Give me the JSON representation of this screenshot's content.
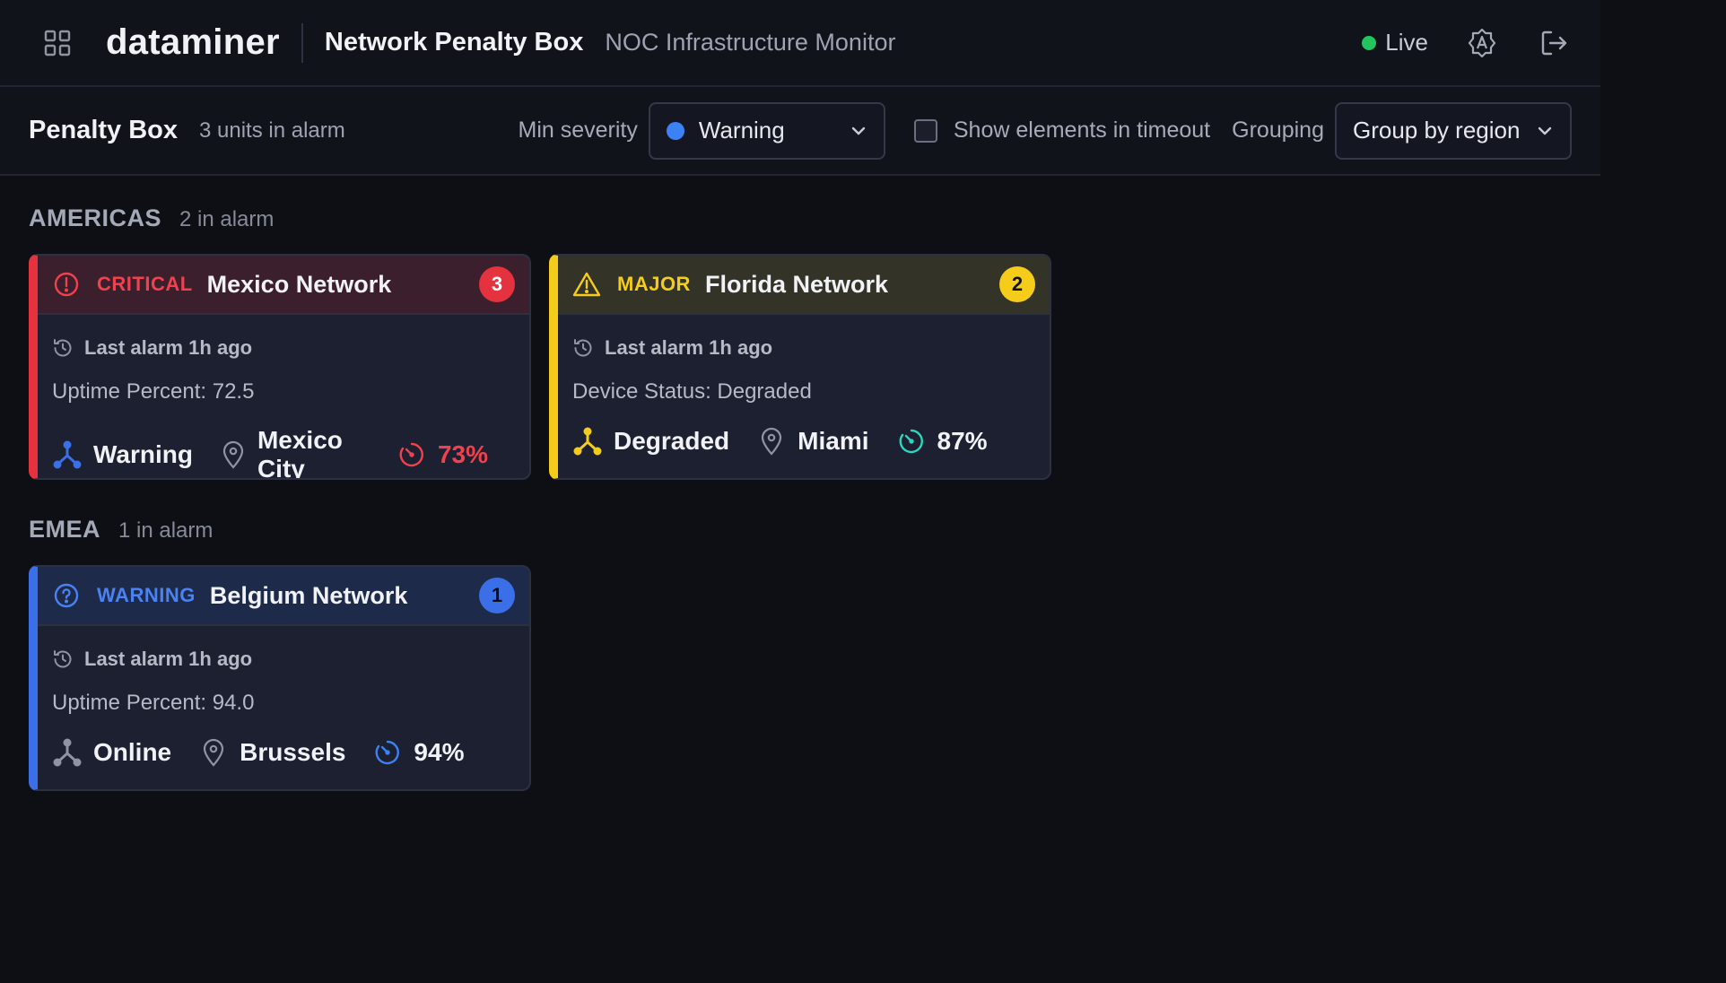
{
  "header": {
    "brand": "dataminer",
    "app_title": "Network Penalty Box",
    "app_subtitle": "NOC Infrastructure Monitor",
    "live_label": "Live"
  },
  "toolbar": {
    "title": "Penalty Box",
    "count": "3 units in alarm",
    "min_severity_label": "Min severity",
    "min_severity_value": "Warning",
    "timeout_label": "Show elements in timeout",
    "grouping_label": "Grouping",
    "grouping_value": "Group by region"
  },
  "colors": {
    "critical": "#e5323f",
    "major": "#f5cc1a",
    "warning": "#3b6fe8",
    "live": "#22c55e",
    "teal": "#2dd4bf"
  },
  "groups": [
    {
      "name": "AMERICAS",
      "count": "2 in alarm",
      "cards": [
        {
          "severity": "CRITICAL",
          "name": "Mexico Network",
          "badge": "3",
          "last_alarm": "Last alarm 1h ago",
          "detail": "Uptime Percent: 72.5",
          "status": "Warning",
          "location": "Mexico City",
          "uptime": "73%"
        },
        {
          "severity": "MAJOR",
          "name": "Florida Network",
          "badge": "2",
          "last_alarm": "Last alarm 1h ago",
          "detail": "Device Status: Degraded",
          "status": "Degraded",
          "location": "Miami",
          "uptime": "87%"
        }
      ]
    },
    {
      "name": "EMEA",
      "count": "1 in alarm",
      "cards": [
        {
          "severity": "WARNING",
          "name": "Belgium Network",
          "badge": "1",
          "last_alarm": "Last alarm 1h ago",
          "detail": "Uptime Percent: 94.0",
          "status": "Online",
          "location": "Brussels",
          "uptime": "94%"
        }
      ]
    }
  ]
}
